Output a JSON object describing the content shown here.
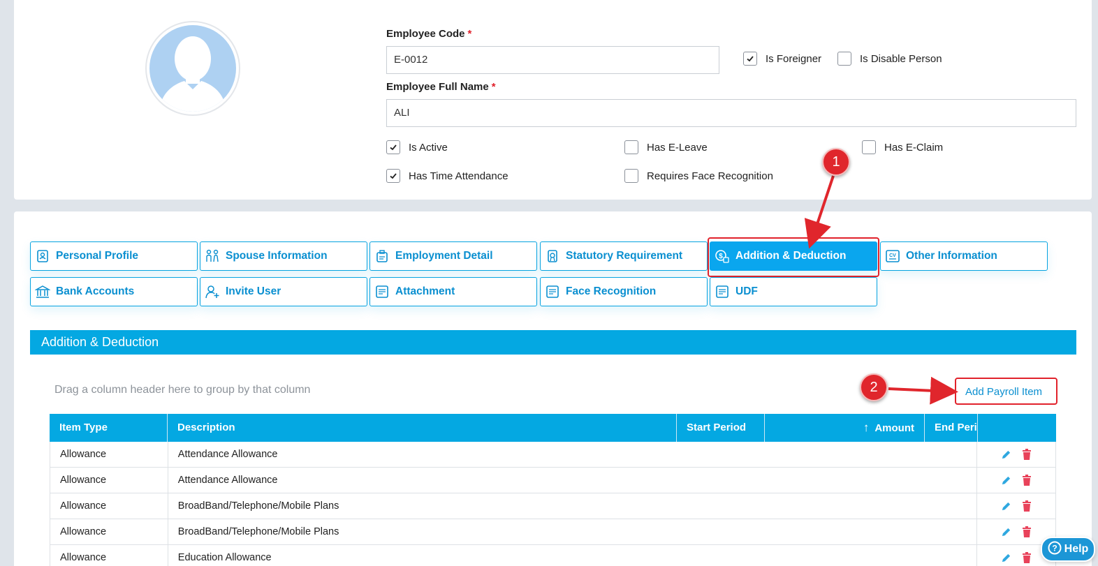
{
  "employee": {
    "code_label": "Employee Code",
    "code_value": "E-0012",
    "name_label": "Employee Full Name",
    "name_value": "ALI",
    "required_mark": "*"
  },
  "flags": {
    "is_foreigner": {
      "label": "Is Foreigner",
      "checked": true
    },
    "is_disable_person": {
      "label": "Is Disable Person",
      "checked": false
    },
    "is_active": {
      "label": "Is Active",
      "checked": true
    },
    "has_e_leave": {
      "label": "Has E-Leave",
      "checked": false
    },
    "has_e_claim": {
      "label": "Has E-Claim",
      "checked": false
    },
    "has_time_attendance": {
      "label": "Has Time Attendance",
      "checked": true
    },
    "requires_face_recognition": {
      "label": "Requires Face Recognition",
      "checked": false
    }
  },
  "tabs": [
    {
      "label": "Personal Profile",
      "icon": "profile-icon"
    },
    {
      "label": "Spouse Information",
      "icon": "couple-icon"
    },
    {
      "label": "Employment Detail",
      "icon": "briefcase-icon"
    },
    {
      "label": "Statutory Requirement",
      "icon": "certificate-icon"
    },
    {
      "label": "Addition & Deduction",
      "icon": "money-icon",
      "active": true
    },
    {
      "label": "Other Information",
      "icon": "cv-icon"
    },
    {
      "label": "Bank Accounts",
      "icon": "bank-icon"
    },
    {
      "label": "Invite User",
      "icon": "add-user-icon"
    },
    {
      "label": "Attachment",
      "icon": "document-icon"
    },
    {
      "label": "Face Recognition",
      "icon": "document-icon"
    },
    {
      "label": "UDF",
      "icon": "document-icon"
    }
  ],
  "section": {
    "title": "Addition & Deduction",
    "group_hint": "Drag a column header here to group by that column",
    "add_button": "Add Payroll Item"
  },
  "grid": {
    "columns": [
      "Item Type",
      "Description",
      "Start Period",
      "Amount",
      "End Peri"
    ],
    "sort_indicator": "↑",
    "rows": [
      {
        "item_type": "Allowance",
        "description": "Attendance Allowance"
      },
      {
        "item_type": "Allowance",
        "description": "Attendance Allowance"
      },
      {
        "item_type": "Allowance",
        "description": "BroadBand/Telephone/Mobile Plans"
      },
      {
        "item_type": "Allowance",
        "description": "BroadBand/Telephone/Mobile Plans"
      },
      {
        "item_type": "Allowance",
        "description": "Education Allowance"
      }
    ]
  },
  "annotations": {
    "badge1": "1",
    "badge2": "2"
  },
  "help": {
    "label": "Help"
  },
  "colors": {
    "accent": "#04a8e2",
    "annotation": "#e0262c",
    "delete": "#e8425a"
  }
}
